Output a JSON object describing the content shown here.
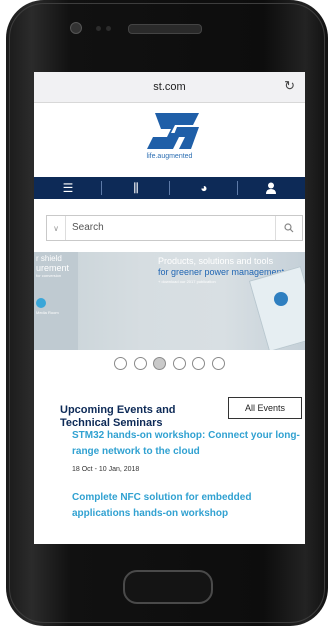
{
  "browser": {
    "url": "st.com",
    "reload_icon": "reload-icon"
  },
  "site": {
    "tagline": "life.augmented",
    "logo_text": "ST"
  },
  "nav": {
    "items": [
      {
        "icon": "menu-icon"
      },
      {
        "icon": "sliders-icon"
      },
      {
        "icon": "globe-icon"
      },
      {
        "icon": "user-icon"
      }
    ]
  },
  "search": {
    "placeholder": "Search"
  },
  "banner": {
    "left_line1": "r shield",
    "left_line2": "urement",
    "left_line3": "for conversion",
    "left_line4": "Media Room",
    "headline1": "Products, solutions and tools",
    "headline2": "for greener power management",
    "headline3": "+ download our 2017 publication"
  },
  "carousel": {
    "count": 6,
    "active": 2
  },
  "events": {
    "title": "Upcoming Events and Technical Seminars",
    "all_events_label": "All Events",
    "items": [
      {
        "title": "STM32 hands-on workshop: Connect your long-range network to the cloud",
        "date": "18 Oct - 10 Jan, 2018"
      },
      {
        "title": "Complete NFC solution for embedded applications hands-on workshop"
      }
    ]
  },
  "colors": {
    "nav_bg": "#0d2a57",
    "link": "#30a1d1",
    "brand": "#2d6fb3"
  }
}
